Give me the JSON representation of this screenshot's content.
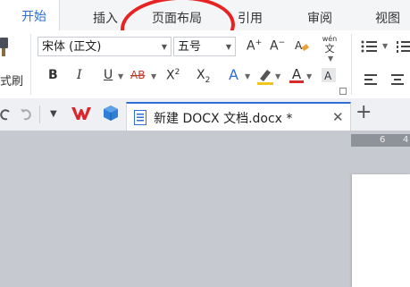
{
  "menu_tabs": {
    "start": "开始",
    "insert": "插入",
    "page_layout": "页面布局",
    "references": "引用",
    "review": "审阅",
    "view": "视图"
  },
  "ribbon": {
    "format_painter_label": "式刷",
    "font_name": "宋体 (正文)",
    "font_size": "五号",
    "bold": "B",
    "italic": "I",
    "underline": "U",
    "strikethrough": "AB",
    "superscript_base": "X",
    "superscript_sup": "2",
    "subscript_base": "X",
    "subscript_sub": "2",
    "text_effect": "A",
    "font_color": "A",
    "grow_font": "A",
    "shrink_font": "A",
    "pinyin_top": "wén",
    "pinyin_bottom": "文"
  },
  "document_tab": {
    "title": "新建 DOCX 文档.docx *"
  },
  "ruler_numbers": [
    "6",
    "4"
  ],
  "colors": {
    "accent": "#2f6ed7",
    "annotation": "#e82222",
    "wps_logo": "#d9272e",
    "cube_icon": "#2f7fd6"
  }
}
